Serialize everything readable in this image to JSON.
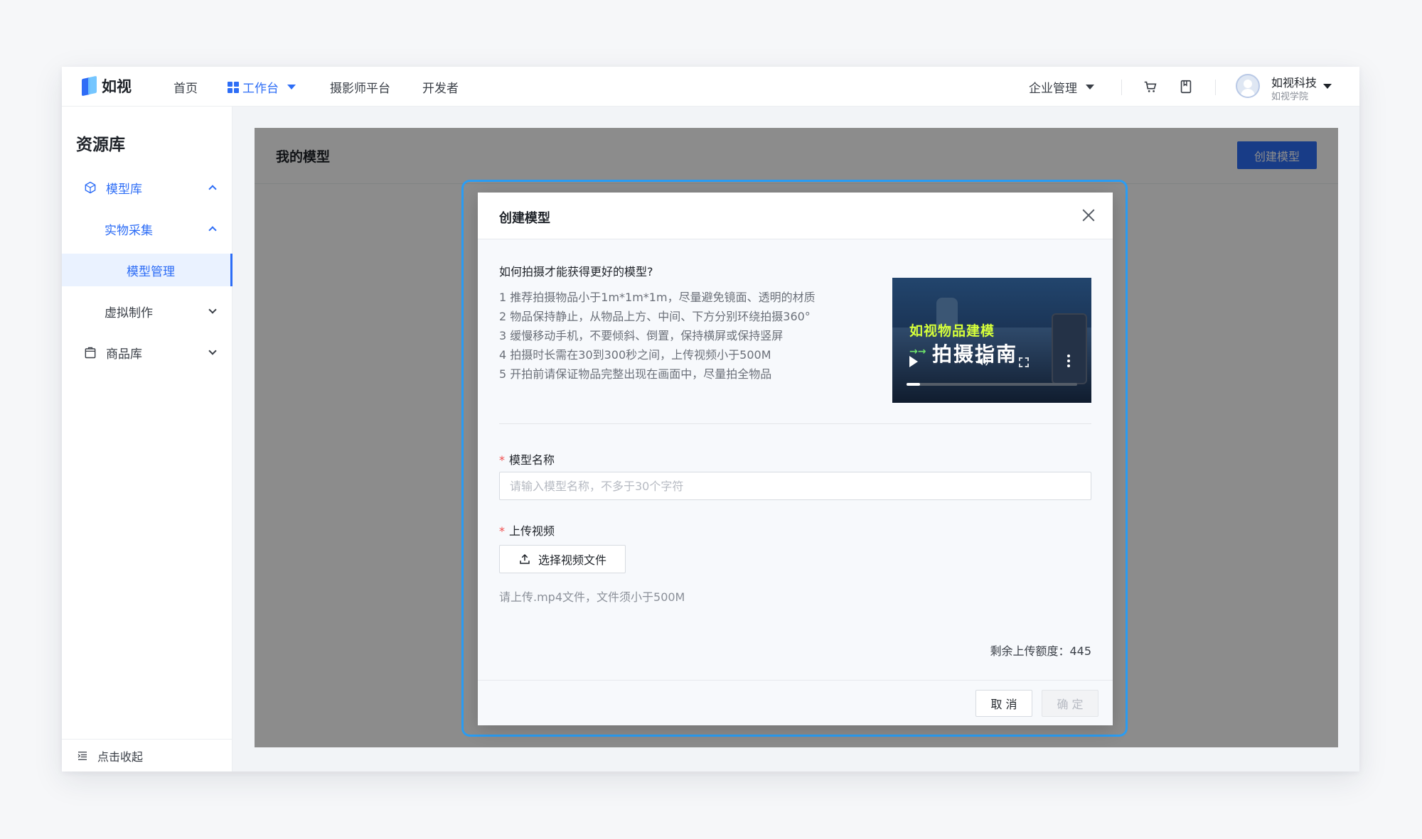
{
  "nav": {
    "logo_text": "如视",
    "home": "首页",
    "workbench": "工作台",
    "photographer": "摄影师平台",
    "developer": "开发者",
    "enterprise": "企业管理",
    "user_name": "如视科技",
    "user_sub": "如视学院"
  },
  "sidebar": {
    "title": "资源库",
    "items": [
      {
        "label": "模型库"
      },
      {
        "label": "实物采集"
      },
      {
        "label": "模型管理"
      },
      {
        "label": "虚拟制作"
      },
      {
        "label": "商品库"
      }
    ],
    "collapse": "点击收起"
  },
  "main": {
    "title": "我的模型",
    "create_button": "创建模型"
  },
  "modal": {
    "title": "创建模型",
    "tips_question": "如何拍摄才能获得更好的模型?",
    "tips": [
      "1 推荐拍摄物品小于1m*1m*1m，尽量避免镜面、透明的材质",
      "2 物品保持静止，从物品上方、中间、下方分别环绕拍摄360°",
      "3 缓慢移动手机，不要倾斜、倒置，保持横屏或保持竖屏",
      "4 拍摄时长需在30到300秒之间，上传视频小于500M",
      "5 开拍前请保证物品完整出现在画面中，尽量拍全物品"
    ],
    "video": {
      "title_line1": "如视物品建模",
      "title_line2": "拍摄指南",
      "progress": 0.08
    },
    "name_label": "模型名称",
    "name_placeholder": "请输入模型名称，不多于30个字符",
    "name_value": "",
    "upload_label": "上传视频",
    "upload_button": "选择视频文件",
    "upload_hint": "请上传.mp4文件，文件须小于500M",
    "quota": "剩余上传额度：445",
    "cancel": "取 消",
    "confirm": "确 定"
  },
  "colors": {
    "accent": "#2d6df6",
    "required": "#f04a4a",
    "modal_highlight": "#2a9df4"
  }
}
